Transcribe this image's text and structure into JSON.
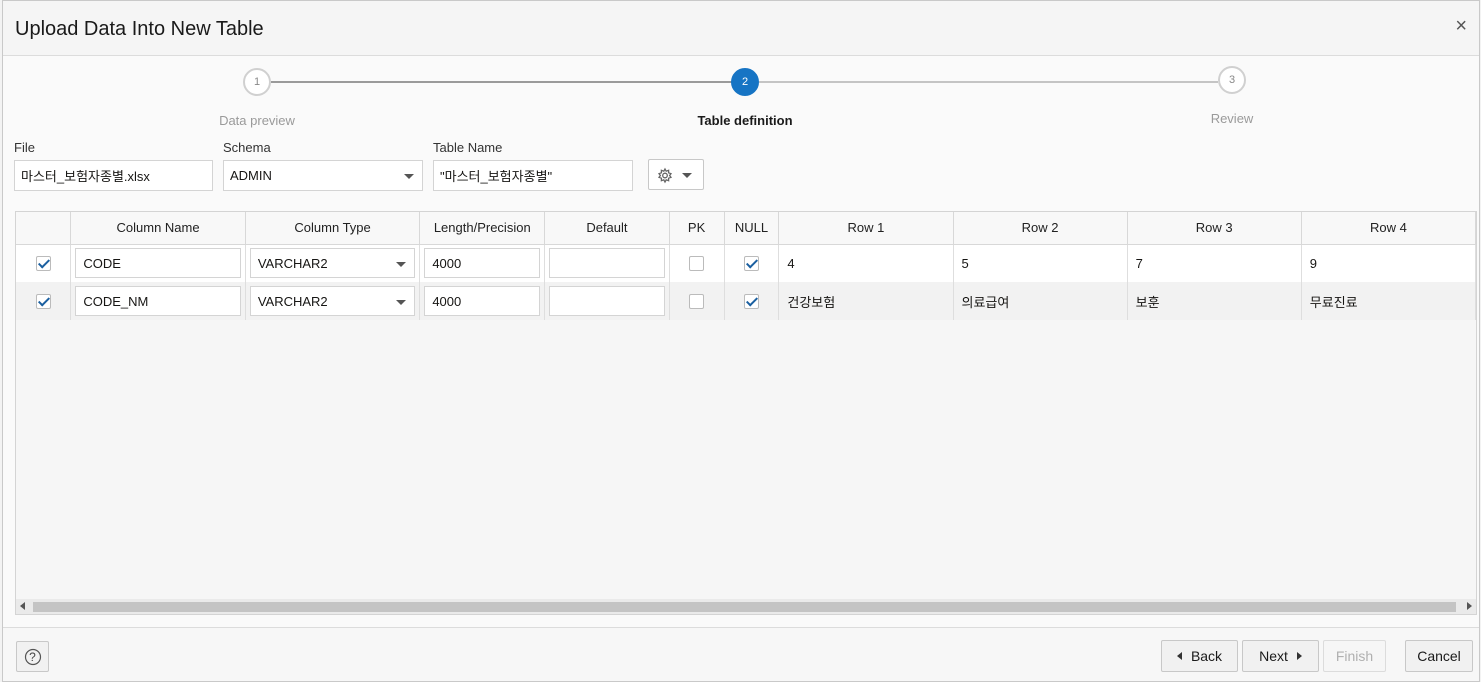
{
  "dialog": {
    "title": "Upload Data Into New Table",
    "close_glyph": "×"
  },
  "train": {
    "steps": [
      {
        "number": "1",
        "label": "Data preview",
        "state": "done"
      },
      {
        "number": "2",
        "label": "Table definition",
        "state": "active"
      },
      {
        "number": "3",
        "label": "Review",
        "state": "pending"
      }
    ]
  },
  "form": {
    "file": {
      "label": "File",
      "value": "마스터_보험자종별.xlsx"
    },
    "schema": {
      "label": "Schema",
      "value": "ADMIN"
    },
    "table_name": {
      "label": "Table Name",
      "value": "\"마스터_보험자종별\""
    },
    "settings_icon": "gear-icon"
  },
  "grid": {
    "headers": [
      "",
      "Column Name",
      "Column Type",
      "Length/Precision",
      "Default",
      "PK",
      "NULL",
      "Row 1",
      "Row 2",
      "Row 3",
      "Row 4"
    ],
    "rows": [
      {
        "selected": true,
        "column_name": "CODE",
        "column_type": "VARCHAR2",
        "length": "4000",
        "default": "",
        "pk": false,
        "null": true,
        "values": [
          "4",
          "5",
          "7",
          "9"
        ]
      },
      {
        "selected": true,
        "column_name": "CODE_NM",
        "column_type": "VARCHAR2",
        "length": "4000",
        "default": "",
        "pk": false,
        "null": true,
        "values": [
          "건강보험",
          "의료급여",
          "보훈",
          "무료진료"
        ]
      }
    ]
  },
  "footer": {
    "help_glyph": "?",
    "back": "Back",
    "next": "Next",
    "finish": "Finish",
    "cancel": "Cancel"
  },
  "colors": {
    "accent": "#1674c4",
    "checkmark": "#1a5fa0"
  }
}
